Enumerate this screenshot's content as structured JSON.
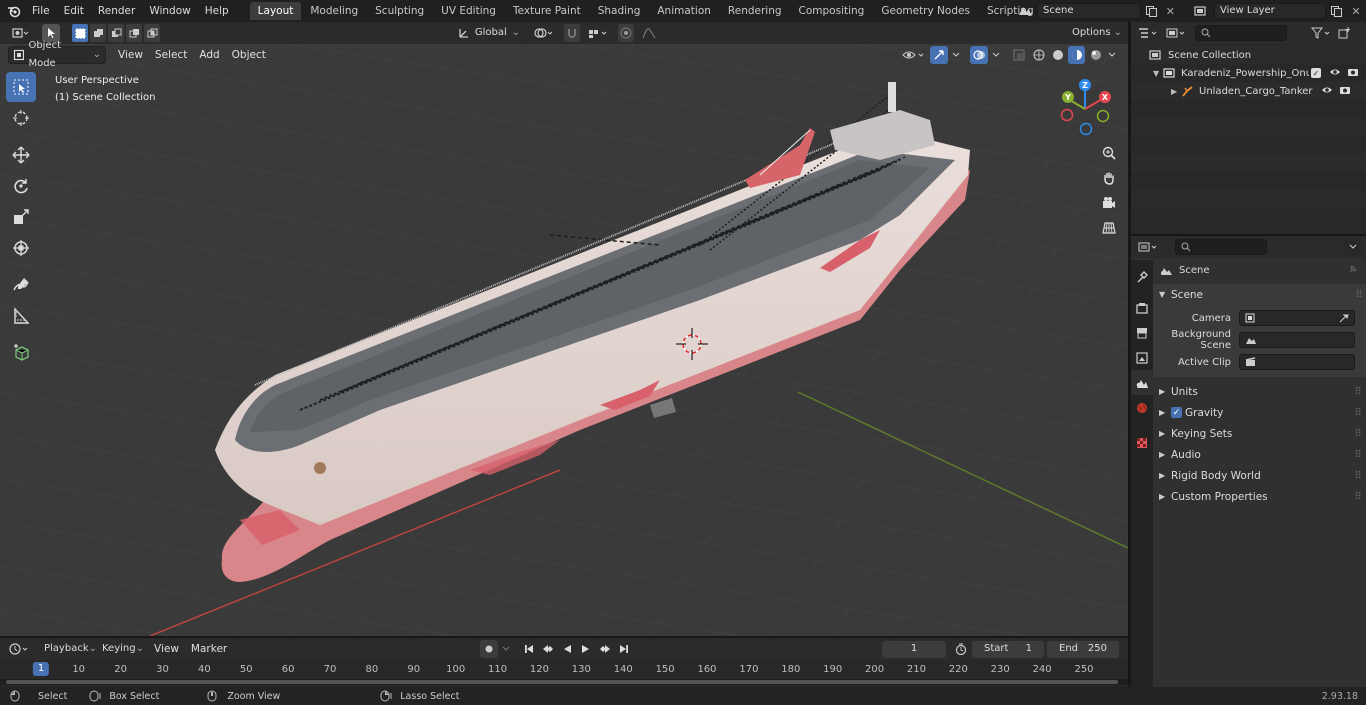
{
  "topbar": {
    "menus": [
      "File",
      "Edit",
      "Render",
      "Window",
      "Help"
    ],
    "workspace_tabs": [
      "Layout",
      "Modeling",
      "Sculpting",
      "UV Editing",
      "Texture Paint",
      "Shading",
      "Animation",
      "Rendering",
      "Compositing",
      "Geometry Nodes",
      "Scripting"
    ],
    "active_tab": "Layout",
    "scene_name": "Scene",
    "view_layer": "View Layer"
  },
  "viewport_header": {
    "mode": "Object Mode",
    "menus": [
      "View",
      "Select",
      "Add",
      "Object"
    ],
    "orientation": "Global",
    "options_label": "Options"
  },
  "viewport": {
    "perspective_label": "User Perspective",
    "collection_label": "(1) Scene Collection",
    "gizmo_axes": [
      "Z",
      "Y",
      "X"
    ]
  },
  "outliner": {
    "root": "Scene Collection",
    "items": [
      {
        "name": "Karadeniz_Powership_Onur_S"
      },
      {
        "name": "Unladen_Cargo_Tanker"
      }
    ]
  },
  "properties": {
    "context_title": "Scene",
    "section_title": "Scene",
    "fields": [
      {
        "label": "Camera",
        "value": ""
      },
      {
        "label": "Background Scene",
        "value": ""
      },
      {
        "label": "Active Clip",
        "value": ""
      }
    ],
    "panels": [
      "Units",
      "Gravity",
      "Keying Sets",
      "Audio",
      "Rigid Body World",
      "Custom Properties"
    ],
    "gravity_checked": true
  },
  "timeline": {
    "menus": [
      "Playback",
      "Keying",
      "View",
      "Marker"
    ],
    "current_frame": "1",
    "start_label": "Start",
    "start": "1",
    "end_label": "End",
    "end": "250",
    "ticks": [
      "1",
      "10",
      "20",
      "30",
      "40",
      "50",
      "60",
      "70",
      "80",
      "90",
      "100",
      "110",
      "120",
      "130",
      "140",
      "150",
      "160",
      "170",
      "180",
      "190",
      "200",
      "210",
      "220",
      "230",
      "240",
      "250"
    ]
  },
  "statusbar": {
    "select": "Select",
    "box_select": "Box Select",
    "zoom_view": "Zoom View",
    "lasso_select": "Lasso Select",
    "version": "2.93.18"
  },
  "colors": {
    "accent": "#4772b3",
    "x_axis": "#e5464e",
    "y_axis": "#88b02c",
    "z_axis": "#2d8ded"
  }
}
